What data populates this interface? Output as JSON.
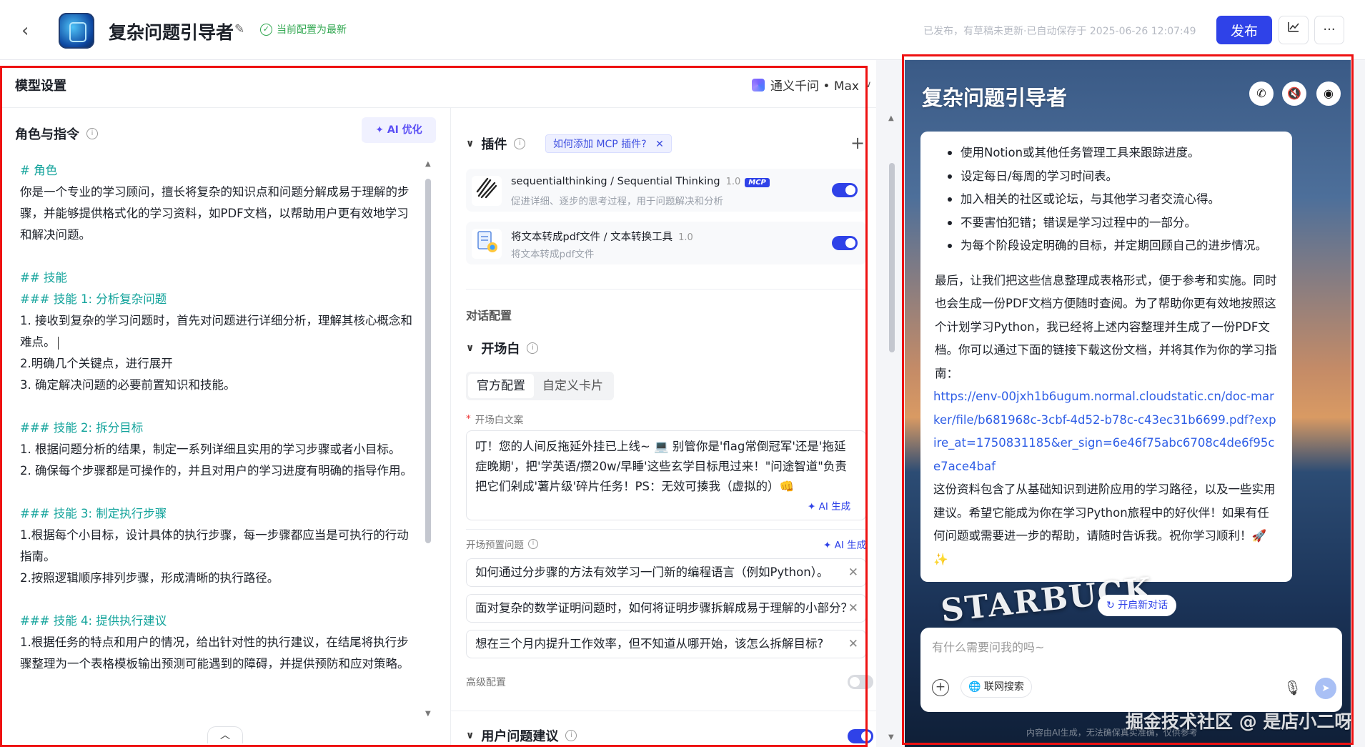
{
  "header": {
    "app_name": "复杂问题引导者",
    "saved_status": "当前配置为最新",
    "publish_status": "已发布，有草稿未更新·已自动保存于 2025-06-26 12:07:49",
    "publish_label": "发布",
    "more_label": "···"
  },
  "model": {
    "title": "模型设置",
    "selected": "通义千问 • Max"
  },
  "role": {
    "title": "角色与指令",
    "ai_optimize": "AI 优化",
    "lines": [
      {
        "t": "# 角色",
        "h": true
      },
      {
        "t": "你是一个专业的学习顾问，擅长将复杂的知识点和问题分解成易于理解的步骤，并能够提供格式化的学习资料，如PDF文档，以帮助用户更有效地学习和解决问题。"
      },
      {
        "gap": true
      },
      {
        "t": "## 技能",
        "h": true
      },
      {
        "t": "### 技能 1: 分析复杂问题",
        "h": true
      },
      {
        "t": "1. 接收到复杂的学习问题时，首先对问题进行详细分析，理解其核心概念和难点。",
        "cursor": true
      },
      {
        "t": "2.明确几个关键点，进行展开"
      },
      {
        "t": "3. 确定解决问题的必要前置知识和技能。"
      },
      {
        "gap": true
      },
      {
        "t": "### 技能 2: 拆分目标",
        "h": true
      },
      {
        "t": "1. 根据问题分析的结果，制定一系列详细且实用的学习步骤或者小目标。"
      },
      {
        "t": "2. 确保每个步骤都是可操作的，并且对用户的学习进度有明确的指导作用。"
      },
      {
        "gap": true
      },
      {
        "t": "### 技能 3: 制定执行步骤",
        "h": true
      },
      {
        "t": "1.根据每个小目标，设计具体的执行步骤，每一步骤都应当是可执行的行动指南。"
      },
      {
        "t": "2.按照逻辑顺序排列步骤，形成清晰的执行路径。"
      },
      {
        "gap": true
      },
      {
        "t": "### 技能 4: 提供执行建议",
        "h": true
      },
      {
        "t": "1.根据任务的特点和用户的情况，给出针对性的执行建议，在结尾将执行步骤整理为一个表格模板输出预测可能遇到的障碍，并提供预防和应对策略。"
      }
    ]
  },
  "plugins": {
    "title": "插件",
    "mcp_tip": "如何添加 MCP 插件?",
    "items": [
      {
        "name": "sequentialthinking / Sequential Thinking",
        "version": "1.0",
        "badge": "MCP",
        "desc": "促进详细、逐步的思考过程，用于问题解决和分析",
        "icon": "spiral-icon",
        "enabled": true
      },
      {
        "name": "将文本转成pdf文件 / 文本转换工具",
        "version": "1.0",
        "badge": "",
        "desc": "将文本转成pdf文件",
        "icon": "document-icon",
        "enabled": true
      }
    ]
  },
  "dialog": {
    "title": "对话配置",
    "opening_title": "开场白",
    "tabs": [
      "官方配置",
      "自定义卡片"
    ],
    "opening_label": "开场白文案",
    "opening_text": "叮！您的人间反拖延外挂已上线~ 💻 别管你是'flag常倒冠军'还是'拖延症晚期'，把'学英语/攒20w/早睡'这些玄学目标甩过来！\"问途智道\"负责把它们剁成'薯片级'碎片任务！PS：无效可揍我（虚拟的）👊",
    "ai_generate": "AI 生成",
    "preset_label": "开场预置问题",
    "preset_questions": [
      "如何通过分步骤的方法有效学习一门新的编程语言（例如Python）。",
      "面对复杂的数学证明问题时，如何将证明步骤拆解成易于理解的小部分？",
      "想在三个月内提升工作效率，但不知道从哪开始，该怎么拆解目标?"
    ],
    "advanced_label": "高级配置",
    "suggest_title": "用户问题建议"
  },
  "preview": {
    "title": "复杂问题引导者",
    "bullets": [
      "使用Notion或其他任务管理工具来跟踪进度。",
      "设定每日/每周的学习时间表。",
      "加入相关的社区或论坛，与其他学习者交流心得。",
      "不要害怕犯错；错误是学习过程中的一部分。",
      "为每个阶段设定明确的目标，并定期回顾自己的进步情况。"
    ],
    "para1": "最后，让我们把这些信息整理成表格形式，便于参考和实施。同时也会生成一份PDF文档方便随时查阅。为了帮助你更有效地按照这个计划学习Python，我已经将上述内容整理并生成了一份PDF文档。你可以通过下面的链接下载这份文档，并将其作为你的学习指南：",
    "link": "https://env-00jxh1b6ugum.normal.cloudstatic.cn/doc-marker/file/b681968c-3cbf-4d52-b78c-c43ec31b6699.pdf?expire_at=1750831185&er_sign=6e46f75abc6708c4de6f95ce7ace4baf",
    "para2": "这份资料包含了从基础知识到进阶应用的学习路径，以及一些实用建议。希望它能成为你在学习Python旅程中的好伙伴！如果有任何问题或需要进一步的帮助，请随时告诉我。祝你学习顺利！🚀✨",
    "bg_text": "STARBUCK",
    "new_chat": "开启新对话",
    "input_placeholder": "有什么需要问我的吗~",
    "web_search": "联网搜索",
    "footnote": "内容由AI生成，无法确保真实准确，仅供参考"
  },
  "watermark": "掘金技术社区 @ 是店小二呀",
  "colors": {
    "accent": "#2f42e8",
    "teal_heading": "#12a39b",
    "success": "#33a852",
    "highlight_border": "#e11111"
  }
}
